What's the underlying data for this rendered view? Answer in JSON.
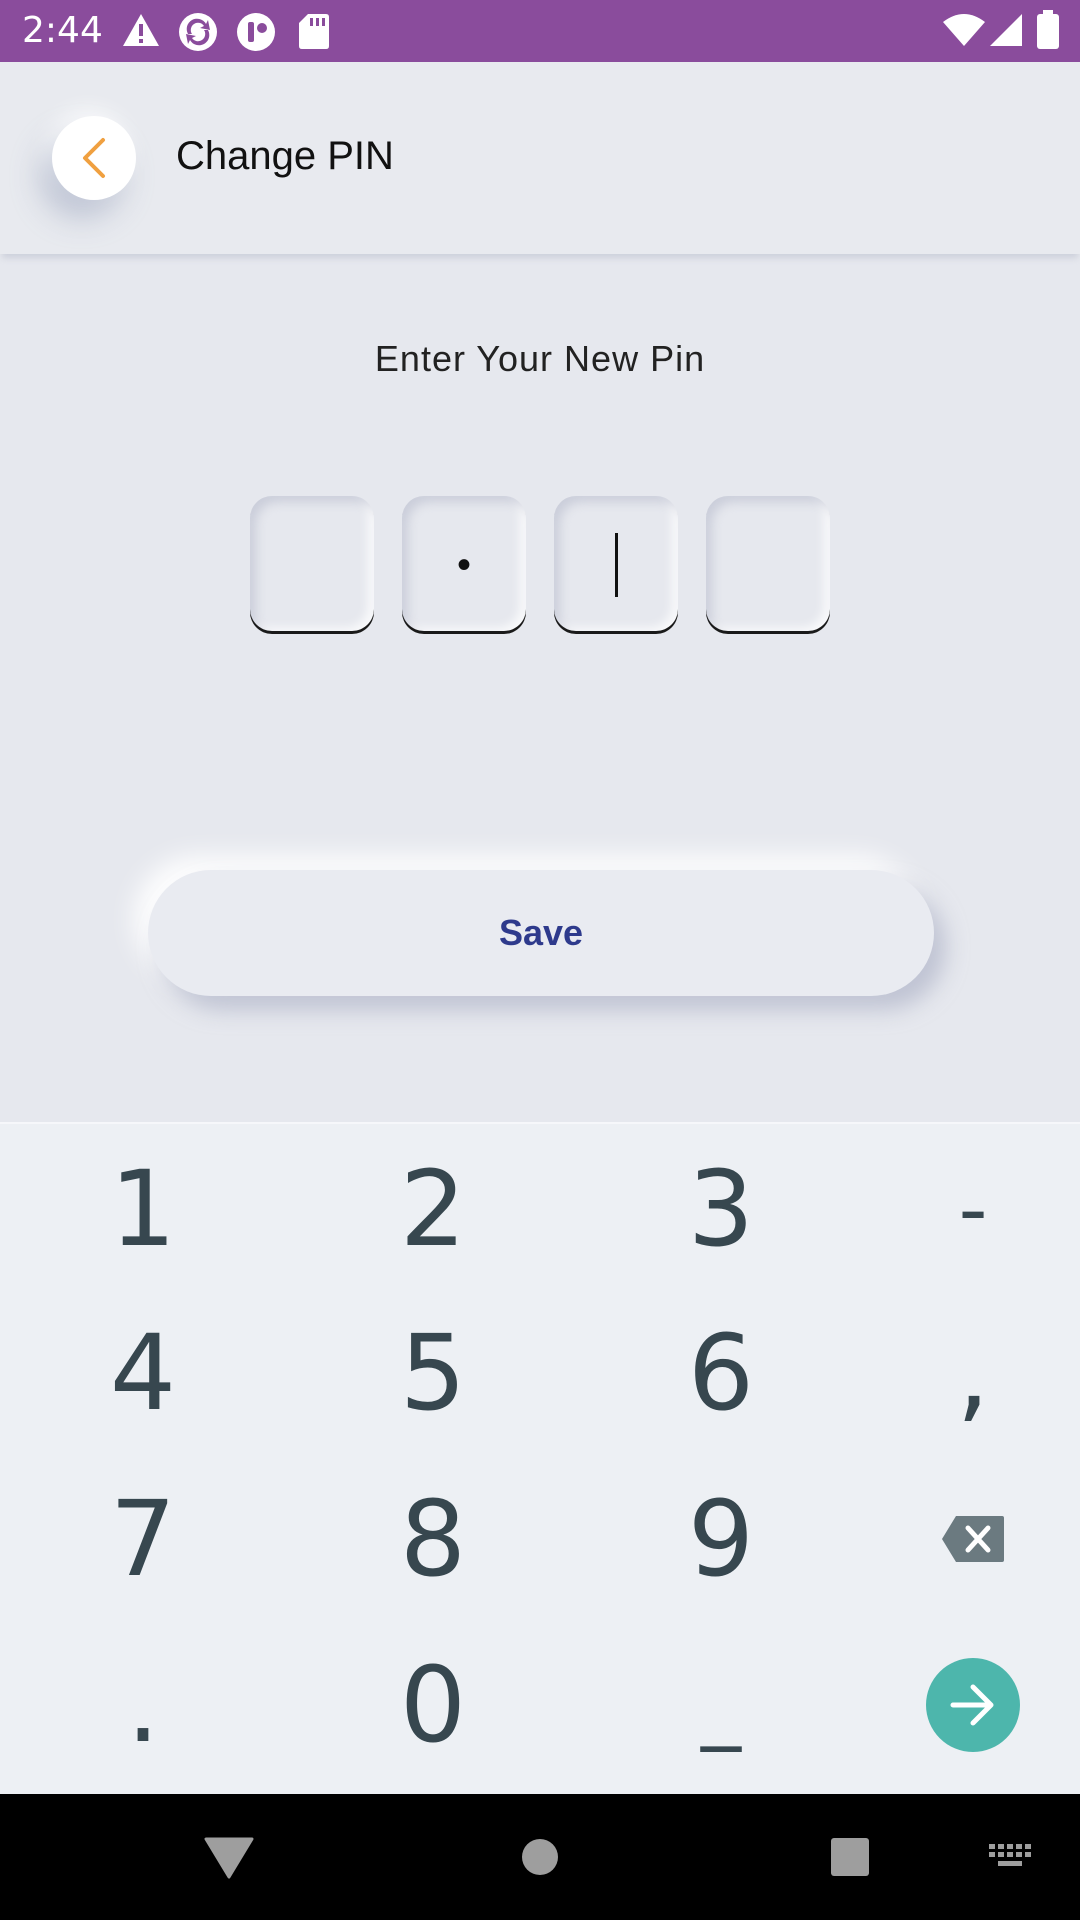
{
  "status_bar": {
    "time": "2:44",
    "icons": [
      "alert-icon",
      "sync-icon",
      "app-icon",
      "sd-card-icon",
      "wifi-icon",
      "signal-icon",
      "battery-icon"
    ]
  },
  "header": {
    "title": "Change PIN",
    "back_icon": "chevron-left-icon",
    "back_color": "#f0a040"
  },
  "pin_entry": {
    "prompt": "Enter Your New Pin",
    "digits": [
      "",
      "•",
      "",
      ""
    ],
    "active_index": 2
  },
  "save_button": {
    "label": "Save",
    "color": "#2e3a8c"
  },
  "keyboard": {
    "rows": [
      [
        "1",
        "2",
        "3",
        "-"
      ],
      [
        "4",
        "5",
        "6",
        ","
      ],
      [
        "7",
        "8",
        "9",
        "backspace-icon"
      ],
      [
        ".",
        "0",
        "_",
        "go-icon"
      ]
    ],
    "accent": "#4db6ac"
  },
  "nav_bar": {
    "icons": [
      "back-triangle-icon",
      "home-circle-icon",
      "recents-square-icon",
      "keyboard-icon"
    ]
  }
}
